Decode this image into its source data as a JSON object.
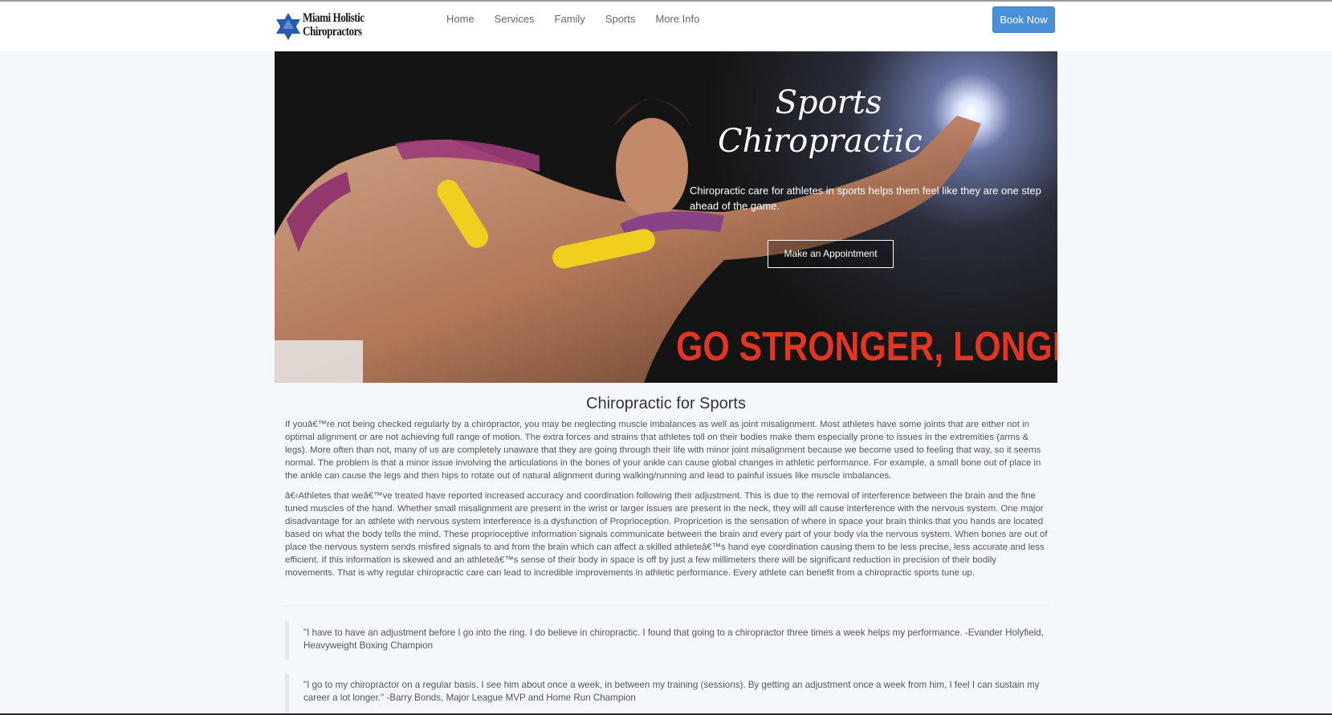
{
  "nav": {
    "logo": {
      "line1": "Miami Holistic",
      "line2": "Chiropractors",
      "icon": "star-of-david-icon"
    },
    "links": [
      "Home",
      "Services",
      "Family",
      "Sports",
      "More Info"
    ],
    "book_label": "Book Now"
  },
  "hero": {
    "title_line1": "Sports",
    "title_line2": "Chiropractic",
    "subtitle": "Chiropractic care for athletes in sports helps them feel like they are one step ahead of the game.",
    "button_label": "Make an Appointment",
    "slogan": "GO STRONGER, LONGER"
  },
  "content": {
    "title": "Chiropractic for Sports",
    "paragraph1": "If youâ€™re not being checked regularly by a chiropractor, you may be neglecting muscle imbalances as well as joint misalignment. Most athletes have some joints that are either not in optimal alignment or are not achieving full range of motion. The extra forces and strains that athletes toll on their bodies make them especially prone to issues in the extremities (arms & legs). More often than not, many of us are completely unaware that they are going through their life with minor joint misalignment because we become used to feeling that way, so it seems normal. The problem is that a minor issue involving the articulations in the bones of your ankle can cause global changes in athletic performance. For example, a small bone out of place in the ankle can cause the legs and then hips to rotate out of natural alignment during walking/running and lead to painful issues like muscle imbalances.",
    "paragraph2": "â€‹Athletes that weâ€™ve treated have reported increased accuracy and coordination following their adjustment. This is due to the removal of interference between the brain and the fine tuned muscles of the hand. Whether small misalignment are present in the wrist or larger issues are present in the neck, they will all cause interference with the nervous system. One major disadvantage for an athlete with nervous system interference is a dysfunction of Proprioception. Propricetion is the sensation of where in space your brain thinks that you hands are located based on what the body tells the mind. These proprioceptive information signals communicate between the brain and every part of your body via the nervous system. When bones are out of place the nervous system sends misfired signals to and from the brain which can affect a skilled athleteâ€™s hand eye coordination causing them to be less precise, less accurate and less efficient. If this information is skewed and an athleteâ€™s sense of their body in space is off by just a few millimeters there will be significant reduction in precision of their bodily movements. That is why regular chiropractic care can lead to incredible improvements in athletic performance. Every athlete can benefit from a chiropractic sports tune up.",
    "quote1": "\"I have to have an adjustment before I go into the ring. I do believe in chiropractic. I found that going to a chiropractor three times a week helps my performance. -Evander Holyfield, Heavyweight Boxing Champion",
    "quote2": "\"I go to my chiropractor on a regular basis. I see him about once a week, in between my training (sessions). By getting an adjustment once a week from him, I feel I can sustain my career a lot longer.\" -Barry Bonds, Major League MVP and Home Run Champion"
  },
  "colors": {
    "accent": "#4a90d9",
    "slogan": "#e33524",
    "page_bg": "#f4f7fb"
  }
}
